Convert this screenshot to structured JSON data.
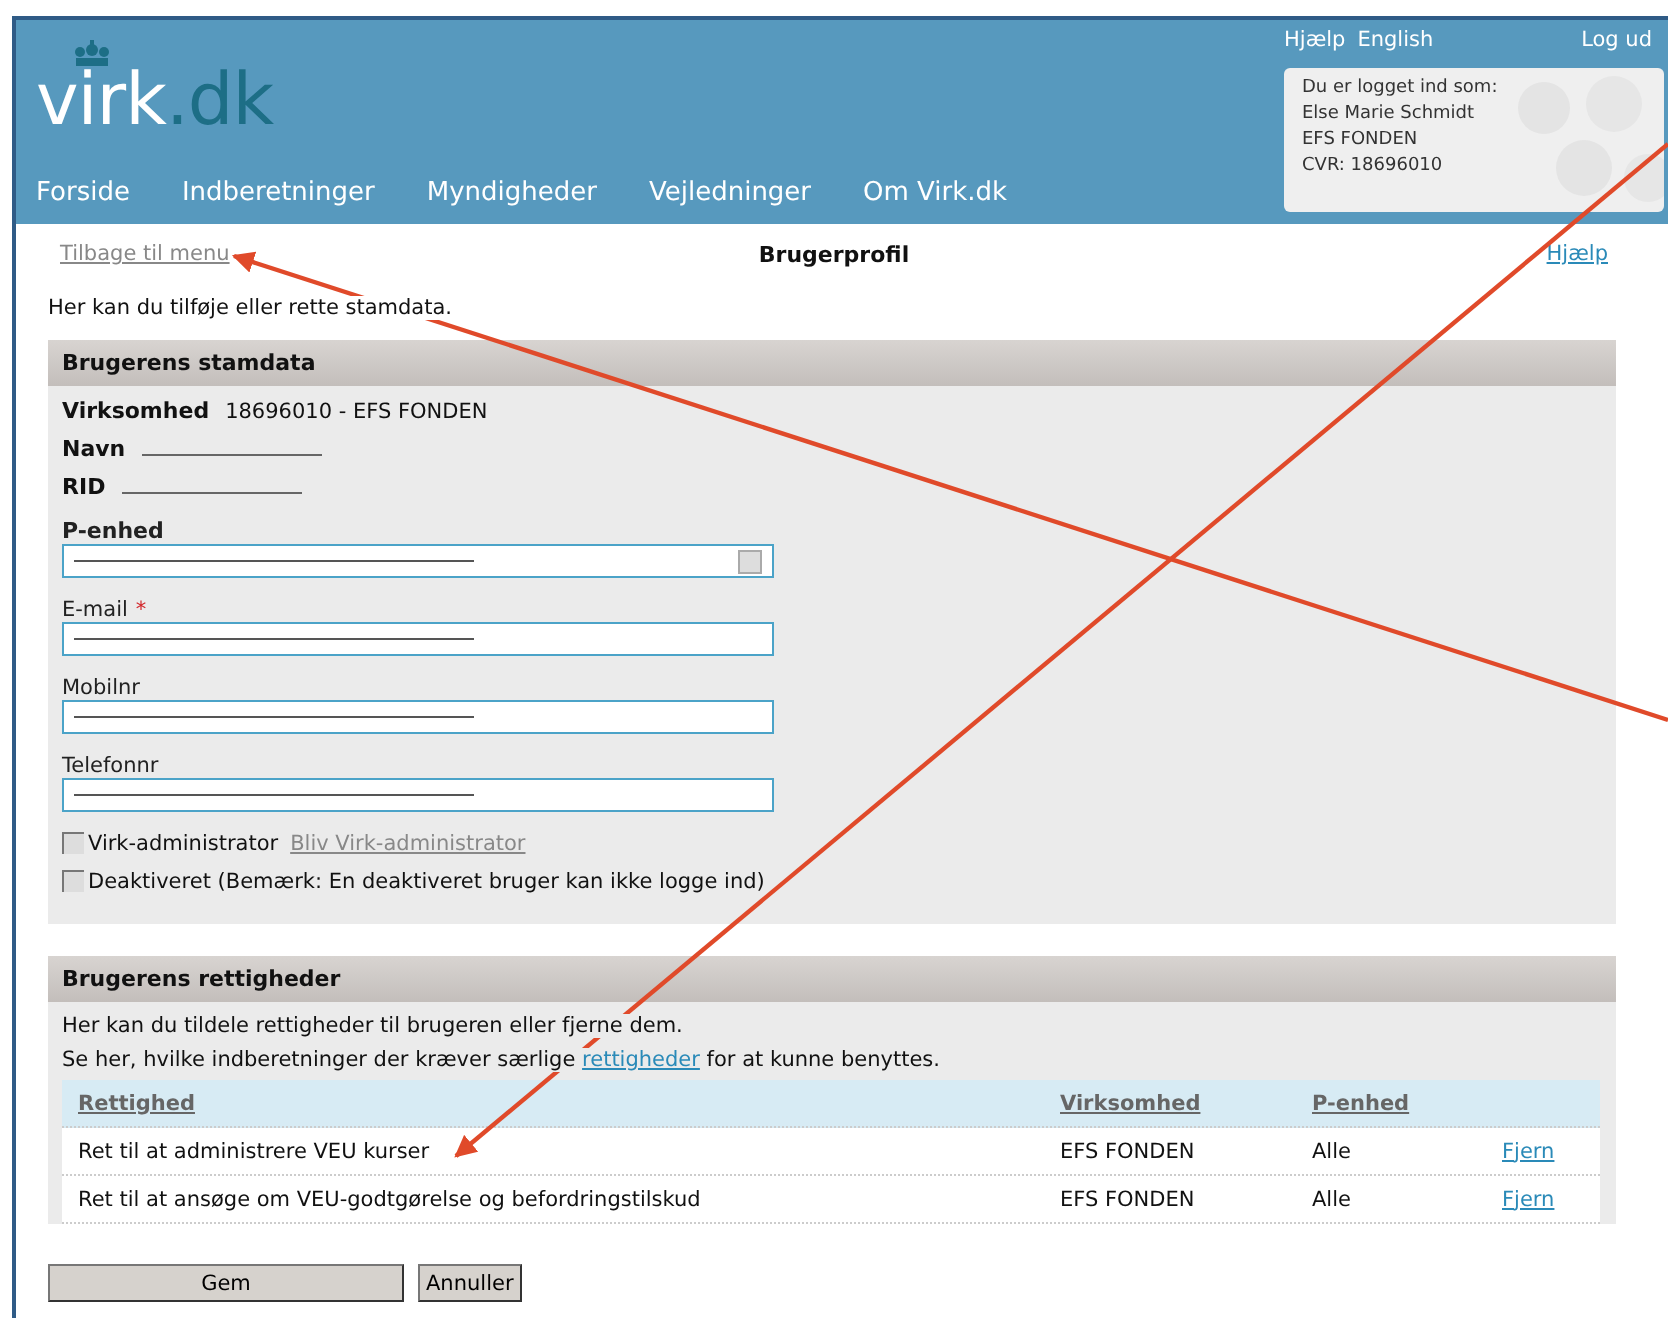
{
  "header": {
    "logo": {
      "name": "virk",
      "suffix": ".dk"
    },
    "top_links": [
      "Hjælp",
      "English"
    ],
    "logout": "Log ud",
    "login_box": [
      "Du er logget ind som:",
      "Else Marie Schmidt",
      "EFS FONDEN",
      "CVR: 18696010"
    ],
    "nav": [
      "Forside",
      "Indberetninger",
      "Myndigheder",
      "Vejledninger",
      "Om Virk.dk"
    ]
  },
  "page": {
    "back_link": "Tilbage til menu",
    "title": "Brugerprofil",
    "help_link": "Hjælp",
    "intro": "Her kan du tilføje eller rette stamdata."
  },
  "stamdata": {
    "title": "Brugerens stamdata",
    "facts": [
      {
        "label": "Virksomhed",
        "kind": "text",
        "value": "18696010 - EFS FONDEN"
      },
      {
        "label": "Navn",
        "kind": "redacted"
      },
      {
        "label": "RID",
        "kind": "redacted"
      }
    ],
    "fields": [
      {
        "label": "P-enhed",
        "kind": "select"
      },
      {
        "label": "E-mail",
        "marker": "*",
        "kind": "input"
      },
      {
        "label": "Mobilnr",
        "kind": "input"
      },
      {
        "label": "Telefonnr",
        "kind": "input"
      }
    ],
    "checkboxes": [
      {
        "label": "Virk-administrator",
        "checked": false,
        "link": "Bliv Virk-administrator"
      },
      {
        "label": "Deaktiveret (Bemærk: En deaktiveret bruger kan ikke logge ind)",
        "checked": false
      }
    ]
  },
  "rights": {
    "title": "Brugerens rettigheder",
    "intro": "Her kan du tildele rettigheder til brugeren eller fjerne dem.",
    "note": {
      "before": "Se her, hvilke indberetninger der kræver særlige",
      "link": "rettigheder",
      "after": "for at kunne benyttes."
    },
    "table": {
      "columns": [
        "Rettighed",
        "Virksomhed",
        "P-enhed"
      ],
      "rows": [
        {
          "right": "Ret til at administrere VEU kurser",
          "company": "EFS FONDEN",
          "unit": "Alle",
          "action": "Fjern"
        },
        {
          "right": "Ret til at ansøge om VEU-godtgørelse og befordringstilskud",
          "company": "EFS FONDEN",
          "unit": "Alle",
          "action": "Fjern"
        }
      ]
    }
  },
  "buttons": [
    {
      "label": "Gem",
      "kind": "wide"
    },
    {
      "label": "Annuller",
      "kind": "plain"
    }
  ]
}
